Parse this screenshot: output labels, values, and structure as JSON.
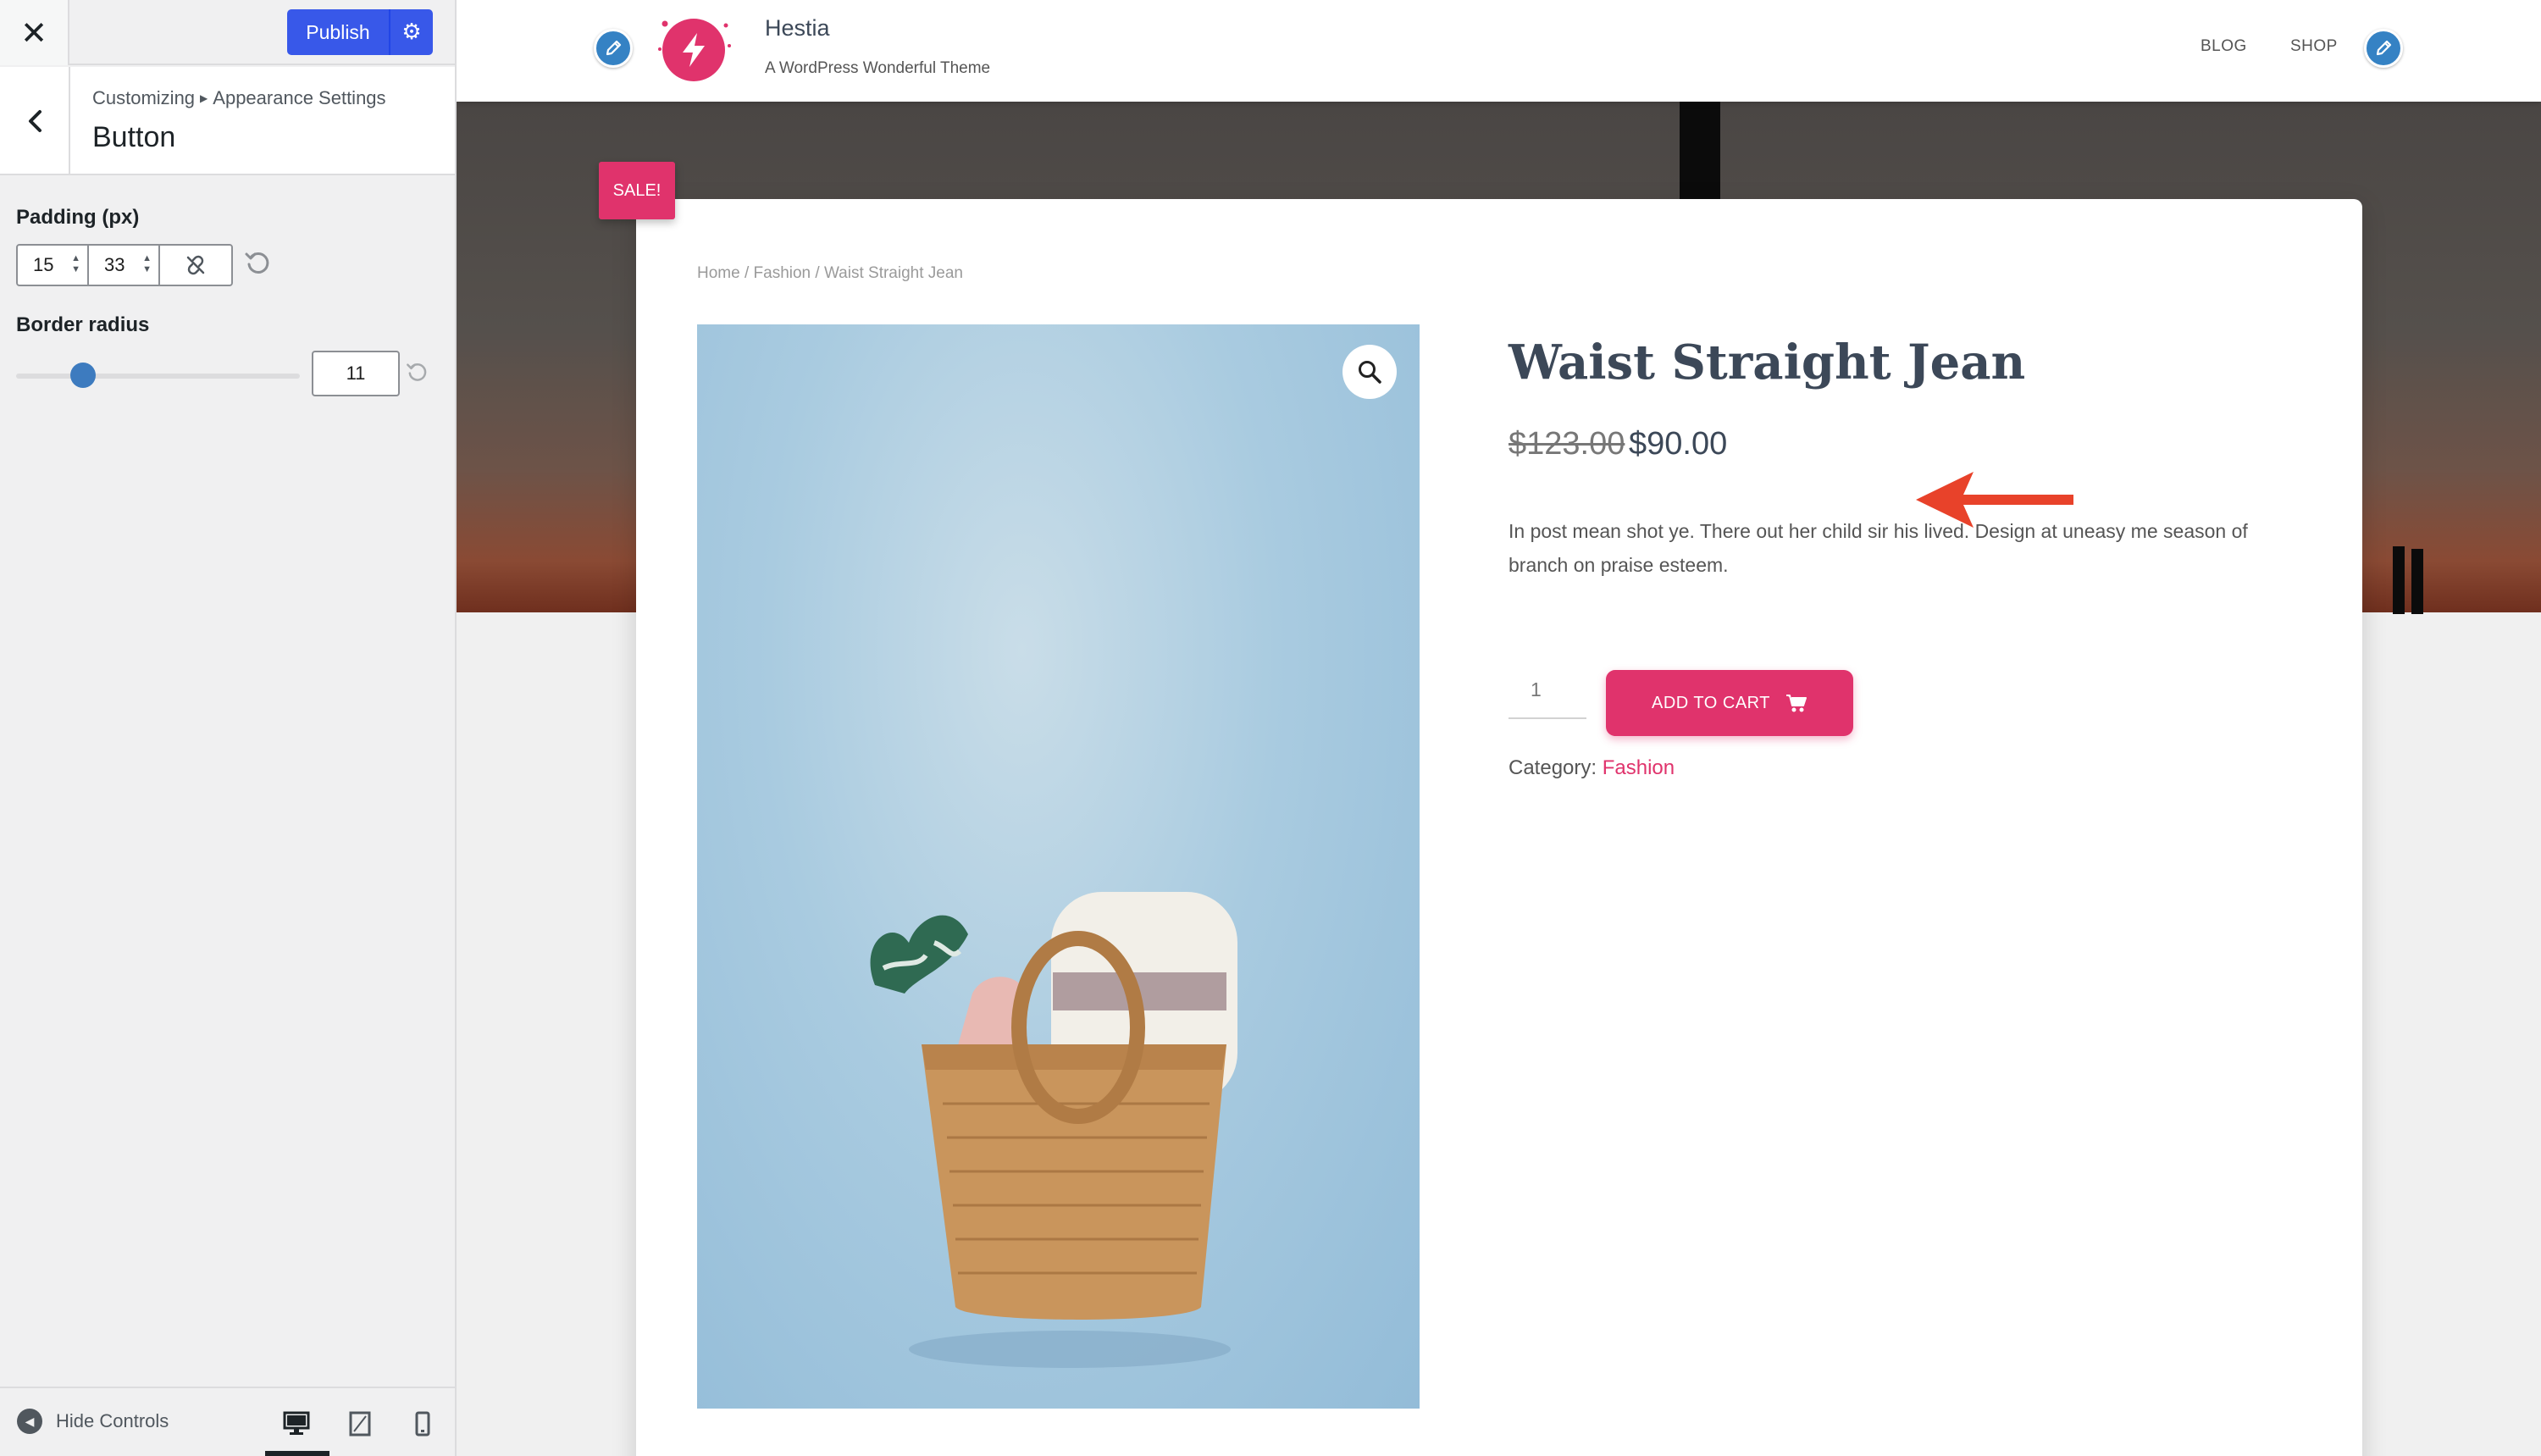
{
  "customizer": {
    "close_icon": "close-icon",
    "publish_label": "Publish",
    "breadcrumb": {
      "root": "Customizing",
      "section": "Appearance Settings"
    },
    "section_title": "Button",
    "padding": {
      "label": "Padding (px)",
      "top_bottom": "15",
      "left_right": "33",
      "linked": false
    },
    "border_radius": {
      "label": "Border radius",
      "value": "11",
      "slider_fraction": 0.165
    },
    "footer": {
      "hide_controls_label": "Hide Controls",
      "active_device": "desktop"
    },
    "colors": {
      "primary": "#3858e9",
      "slider": "#3d7bbf",
      "background": "#f0f0f1"
    }
  },
  "site": {
    "title": "Hestia",
    "tagline": "A WordPress Wonderful Theme",
    "nav": [
      "BLOG",
      "SHOP"
    ],
    "accent": "#e0336c"
  },
  "product": {
    "sale_badge": "SALE!",
    "breadcrumb": "Home / Fashion / Waist Straight Jean",
    "title": "Waist Straight Jean",
    "old_price": "$123.00",
    "price": "$90.00",
    "description": "In post mean shot ye. There out her child sir his lived. Design at uneasy me season of branch on praise esteem.",
    "quantity": "1",
    "add_to_cart": "ADD TO CART",
    "category_label": "Category:",
    "category": "Fashion"
  }
}
